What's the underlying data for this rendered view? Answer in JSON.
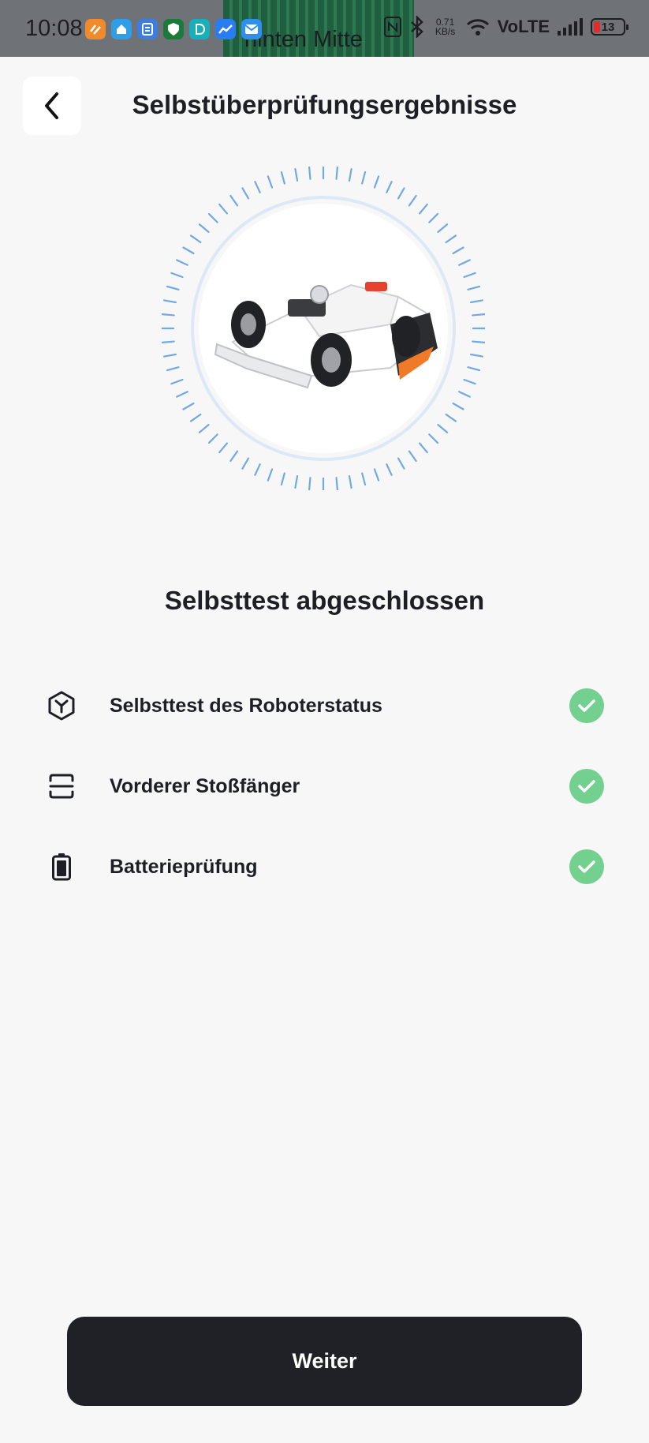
{
  "status_bar": {
    "time": "10:08",
    "background_text": "hinten Mitte",
    "net_speed_value": "0.71",
    "net_speed_unit": "KB/s",
    "network_label": "VoLTE",
    "battery_level": "13",
    "app_icons": [
      "orange-app-icon",
      "house-app-icon",
      "notes-app-icon",
      "shield-app-icon",
      "d-app-icon",
      "stocks-app-icon",
      "mail-app-icon"
    ],
    "icons": [
      "nfc-icon",
      "bluetooth-icon",
      "wifi-icon",
      "signal-icon",
      "battery-icon"
    ]
  },
  "header": {
    "back_icon": "chevron-left-icon",
    "title": "Selbstüberprüfungsergebnisse"
  },
  "illustration": {
    "subject": "robot-lawnmower-image",
    "ring_color": "#5b9be0"
  },
  "result": {
    "title": "Selbsttest abgeschlossen"
  },
  "checks": [
    {
      "icon": "robot-status-icon",
      "label": "Selbsttest des Roboterstatus",
      "status_icon": "check-icon",
      "status": "passed"
    },
    {
      "icon": "bumper-icon",
      "label": "Vorderer Stoßfänger",
      "status_icon": "check-icon",
      "status": "passed"
    },
    {
      "icon": "battery-check-icon",
      "label": "Batterieprüfung",
      "status_icon": "check-icon",
      "status": "passed"
    }
  ],
  "footer": {
    "next_label": "Weiter"
  },
  "colors": {
    "background": "#f7f7f7",
    "success": "#74d08f",
    "button": "#1f2126",
    "accent_ring": "#5b9be0"
  }
}
